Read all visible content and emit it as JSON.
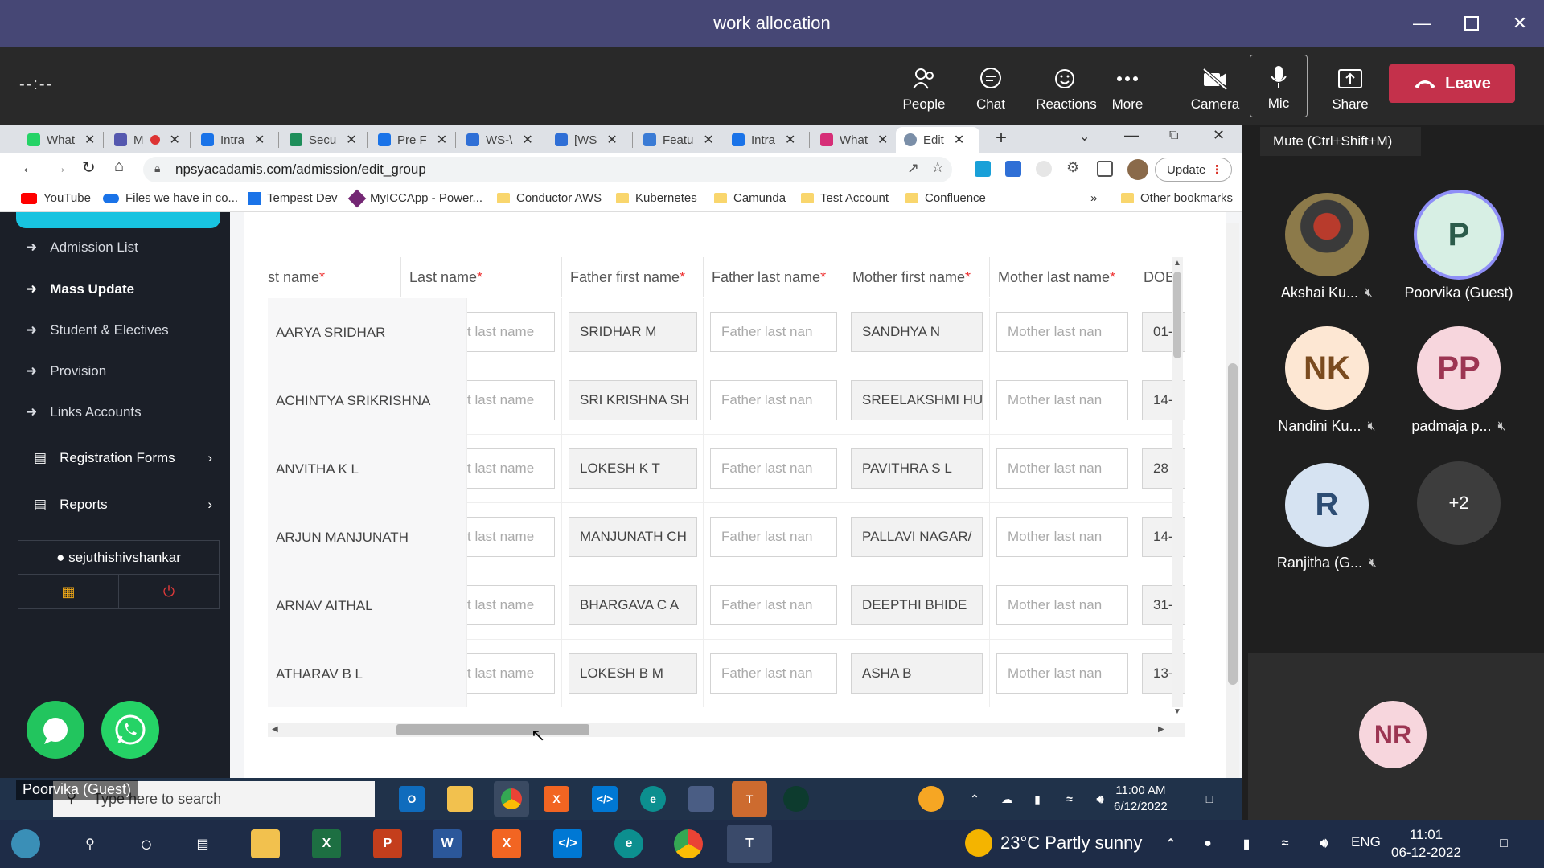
{
  "teams": {
    "window_title": "work allocation",
    "timer": "--:--",
    "toolbar": {
      "people": "People",
      "chat": "Chat",
      "reactions": "Reactions",
      "more": "More",
      "camera": "Camera",
      "mic": "Mic",
      "share": "Share",
      "leave": "Leave"
    },
    "tooltip": "Mute (Ctrl+Shift+M)",
    "participants": [
      {
        "initials": "",
        "name": "Akshai Ku...",
        "muted": true,
        "bg": "#6b5a3a"
      },
      {
        "initials": "P",
        "name": "Poorvika (Guest)",
        "muted": false,
        "bg": "#d7efe4"
      },
      {
        "initials": "NK",
        "name": "Nandini Ku...",
        "muted": true,
        "bg": "#fde7d3"
      },
      {
        "initials": "PP",
        "name": "padmaja p...",
        "muted": true,
        "bg": "#f7d6dd"
      },
      {
        "initials": "R",
        "name": "Ranjitha (G...",
        "muted": true,
        "bg": "#d6e3f2"
      },
      {
        "initials": "+2",
        "name": "",
        "muted": false,
        "bg": "#3d3d3d"
      }
    ],
    "self_initials": "NR",
    "shared_by": "Poorvika (Guest)"
  },
  "browser": {
    "tabs": [
      "What",
      "M",
      "Intra",
      "Secu",
      "Pre F",
      "WS-\\",
      "[WS",
      "Featu",
      "Intra",
      "What",
      "Edit"
    ],
    "url": "npsyacadamis.com/admission/edit_group",
    "update": "Update",
    "bookmarks": [
      "YouTube",
      "Files we have in co...",
      "Tempest Dev",
      "MyICCApp - Power...",
      "Conductor AWS",
      "Kubernetes",
      "Camunda",
      "Test Account",
      "Confluence",
      "»",
      "Other bookmarks"
    ]
  },
  "sidebar": {
    "items": [
      "Admission List",
      "Mass Update",
      "Student & Electives",
      "Provision",
      "Links Accounts"
    ],
    "registration": "Registration Forms",
    "reports": "Reports",
    "user": "sejuthishivshankar"
  },
  "grid": {
    "headers": [
      {
        "label": "st name",
        "req": "*"
      },
      {
        "label": "Last name",
        "req": "*"
      },
      {
        "label": "Father first name",
        "req": "*"
      },
      {
        "label": "Father last name",
        "req": "*"
      },
      {
        "label": "Mother first name",
        "req": "*"
      },
      {
        "label": "Mother last name",
        "req": "*"
      },
      {
        "label": "DOB",
        "req": ""
      }
    ],
    "placeholders": {
      "last": "t last name",
      "father_last": "Father last nan",
      "mother_last": "Mother last nan"
    },
    "rows": [
      {
        "first": "AARYA SRIDHAR",
        "father": "SRIDHAR M",
        "mother": "SANDHYA N",
        "dob": "01-"
      },
      {
        "first": "ACHINTYA SRIKRISHNA",
        "father": "SRI KRISHNA SH",
        "mother": "SREELAKSHMI HU",
        "dob": "14-"
      },
      {
        "first": "ANVITHA K L",
        "father": "LOKESH K T",
        "mother": "PAVITHRA S L",
        "dob": "28"
      },
      {
        "first": "ARJUN MANJUNATH",
        "father": "MANJUNATH CH",
        "mother": "PALLAVI NAGAR/",
        "dob": "14-"
      },
      {
        "first": "ARNAV AITHAL",
        "father": "BHARGAVA C A",
        "mother": "DEEPTHI BHIDE",
        "dob": "31-"
      },
      {
        "first": "ATHARAV B L",
        "father": "LOKESH B M",
        "mother": "ASHA B",
        "dob": "13-"
      }
    ]
  },
  "inner_taskbar": {
    "search": "Type here to search",
    "time": "11:00 AM",
    "date": "6/12/2022"
  },
  "outer_taskbar": {
    "weather": "23°C  Partly sunny",
    "lang": "ENG",
    "time": "11:01",
    "date": "06-12-2022"
  }
}
